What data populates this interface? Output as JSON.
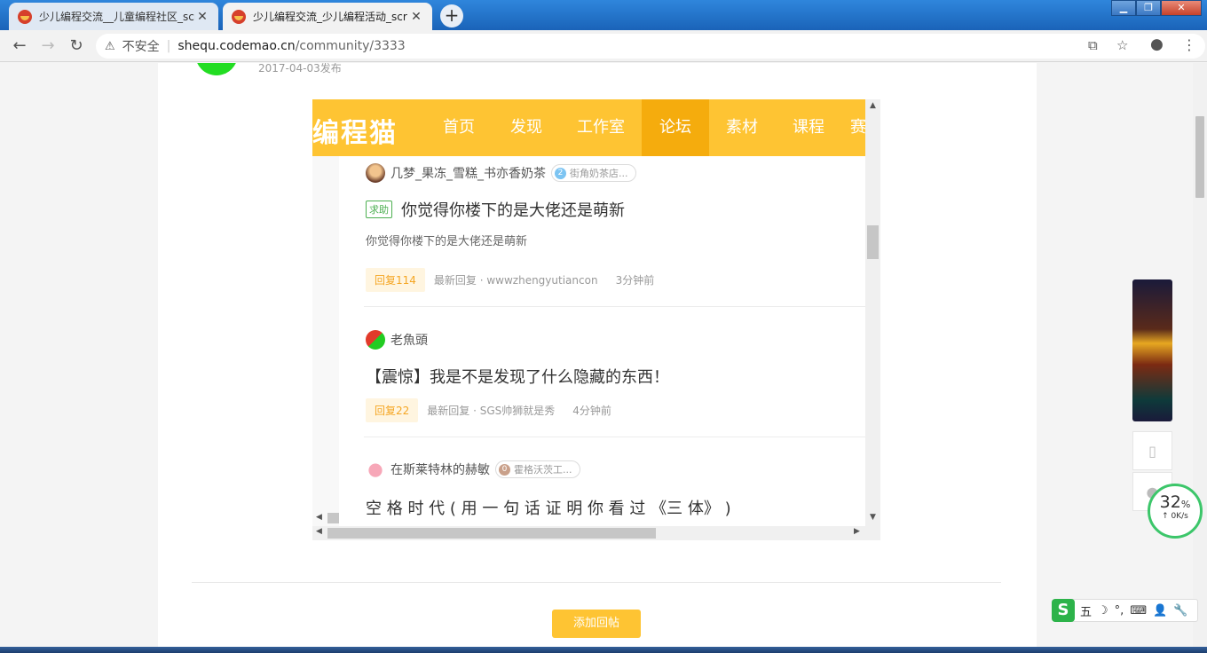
{
  "browser": {
    "tabs": [
      {
        "title": "少儿编程交流__儿童编程社区_scr",
        "active": false
      },
      {
        "title": "少儿编程交流_少儿编程活动_scr",
        "active": true
      }
    ],
    "new_tab": "+",
    "window_buttons": {
      "minimize": "▁",
      "maximize": "❐",
      "close": "✕"
    },
    "back": "←",
    "forward": "→",
    "reload": "↻",
    "security_icon": "⚠",
    "security_label": "不安全",
    "separator": "|",
    "url_host": "shequ.codemao.cn",
    "url_path": "/community/3333",
    "extension_icon": "puzzle-icon",
    "bookmark_icon": "☆",
    "profile_icon": "●",
    "menu_icon": "⋮"
  },
  "post": {
    "date": "2017-04-03发布",
    "reply_button": "添加回帖"
  },
  "embedded": {
    "logo": "编程猫",
    "nav": [
      {
        "label": "首页",
        "active": false
      },
      {
        "label": "发现",
        "active": false
      },
      {
        "label": "工作室",
        "active": false
      },
      {
        "label": "论坛",
        "active": true
      },
      {
        "label": "素材",
        "active": false
      },
      {
        "label": "课程",
        "active": false
      },
      {
        "label": "赛",
        "active": false
      }
    ],
    "threads": [
      {
        "author": "几梦_果冻_雪糕_书亦香奶茶",
        "level": "2",
        "level_color": "#7cc4f2",
        "badge": "街角奶茶店...",
        "tag": "求助",
        "title": "你觉得你楼下的是大佬还是萌新",
        "desc": "你觉得你楼下的是大佬还是萌新",
        "replies": "回复114",
        "last_reply": "最新回复 · wwwzhengyutiancon",
        "time": "3分钟前"
      },
      {
        "author": "老魚頭",
        "title": "【震惊】我是不是发现了什么隐藏的东西！",
        "replies": "回复22",
        "last_reply": "最新回复 · SGS帅狮就是秀",
        "time": "4分钟前"
      },
      {
        "author": "在斯莱特林的赫敏",
        "level": "0",
        "level_color": "#c9a08a",
        "badge": "霍格沃茨工...",
        "title": "空 格 时 代 ( 用 一 句 话 证 明 你 看 过 《三 体》 )"
      }
    ]
  },
  "widgets": {
    "speed_percent": "32",
    "speed_unit": "%",
    "speed_rate": "↑ 0K/s",
    "ime_items": [
      "五",
      "☽",
      "°,",
      "⌨",
      "👤",
      "🔧"
    ],
    "ime_logo": "S"
  }
}
